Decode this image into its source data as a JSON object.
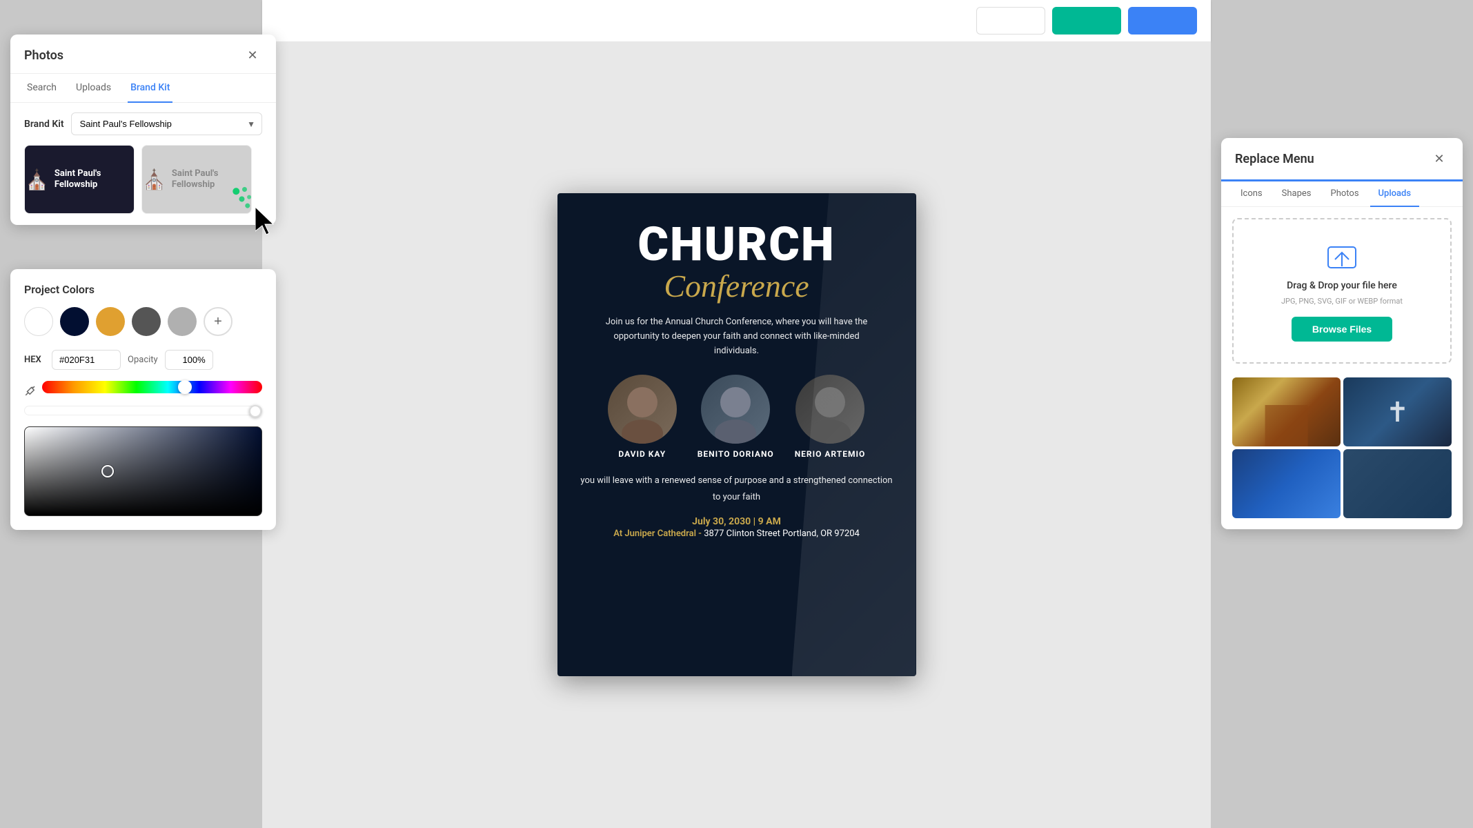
{
  "app": {
    "background_color": "#c8c8c8"
  },
  "photos_panel": {
    "title": "Photos",
    "tabs": [
      {
        "label": "Search",
        "active": false
      },
      {
        "label": "Uploads",
        "active": false
      },
      {
        "label": "Brand Kit",
        "active": true
      }
    ],
    "brand_kit_label": "Brand Kit",
    "brand_kit_value": "Saint Paul's Fellowship",
    "logo_dark_text": "Saint Paul's Fellowship",
    "logo_light_text": "Saint Paul's Fellowship"
  },
  "colors_panel": {
    "title": "Project Colors",
    "hex_label": "HEX",
    "hex_value": "#020F31",
    "opacity_label": "Opacity",
    "opacity_value": "100%",
    "swatches": [
      {
        "color": "#ffffff",
        "label": "white"
      },
      {
        "color": "#020F31",
        "label": "navy"
      },
      {
        "color": "#e0a030",
        "label": "gold"
      },
      {
        "color": "#555555",
        "label": "gray"
      },
      {
        "color": "#b0b0b0",
        "label": "light-gray"
      }
    ]
  },
  "toolbar": {
    "buttons": [
      {
        "label": "",
        "style": "white"
      },
      {
        "label": "",
        "style": "green"
      },
      {
        "label": "",
        "style": "blue"
      }
    ]
  },
  "poster": {
    "title_line1": "CHURCH",
    "title_line2": "Conference",
    "description": "Join us for the Annual Church Conference, where you will have the opportunity to deepen your faith and connect with like-minded individuals.",
    "speakers": [
      {
        "name": "DAVID KAY"
      },
      {
        "name": "BENITO DORIANO"
      },
      {
        "name": "NERIO ARTEMIO"
      }
    ],
    "bottom_text": "you will leave with a renewed sense of purpose and a strengthened connection to your faith",
    "date": "July 30, 2030 | 9 AM",
    "location_label": "At Juniper Cathedral -",
    "address": "3877 Clinton Street Portland, OR 97204"
  },
  "replace_panel": {
    "title": "Replace Menu",
    "tabs": [
      {
        "label": "Icons",
        "active": false
      },
      {
        "label": "Shapes",
        "active": false
      },
      {
        "label": "Photos",
        "active": false
      },
      {
        "label": "Uploads",
        "active": true
      }
    ],
    "upload_area": {
      "title": "Drag & Drop your file here",
      "subtitle": "JPG, PNG, SVG, GIF or WEBP format",
      "button_label": "Browse Files"
    }
  }
}
